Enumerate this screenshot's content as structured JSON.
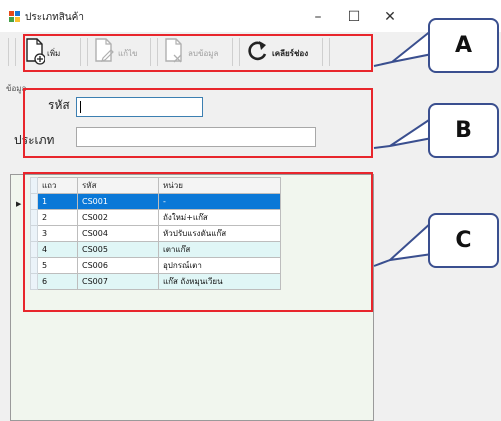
{
  "window": {
    "title": "ประเภทสินค้า",
    "minimize": "–",
    "maximize": "☐",
    "close": "✕"
  },
  "toolbar": {
    "add_label": "เพิ่ม",
    "edit_label": "แก้ไข",
    "delete_label": "ลบข้อมูล",
    "clear_label": "เคลียร์ช่อง"
  },
  "form": {
    "group_title": "ข้อมูล",
    "code_label": "รหัส",
    "code_value": "",
    "type_label": "ประเภท",
    "type_value": ""
  },
  "grid": {
    "headers": [
      "แถว",
      "รหัส",
      "หน่วย"
    ],
    "rows": [
      [
        "1",
        "CS001",
        "-"
      ],
      [
        "2",
        "CS002",
        "ถังใหม่+แก๊ส"
      ],
      [
        "3",
        "CS004",
        "หัวปรับแรงดันแก๊ส"
      ],
      [
        "4",
        "CS005",
        "เตาแก๊ส"
      ],
      [
        "5",
        "CS006",
        "อุปกรณ์เตา"
      ],
      [
        "6",
        "CS007",
        "แก๊ส ถังหมุนเวียน"
      ]
    ],
    "selected_row": 1
  },
  "annotations": {
    "a": "A",
    "b": "B",
    "c": "C"
  },
  "colors": {
    "annotation_border": "#e8262c",
    "callout_border": "#3a4f8f",
    "selection": "#0a78d7",
    "grid_alt_row": "#e0f6f6"
  }
}
